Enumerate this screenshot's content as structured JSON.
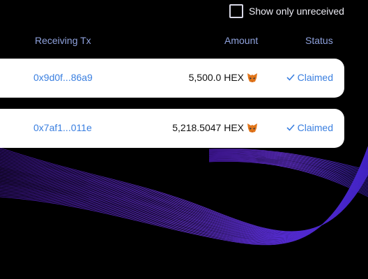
{
  "filter": {
    "label": "Show only unreceived",
    "checked": false
  },
  "columns": {
    "receiving_tx": "Receiving Tx",
    "amount": "Amount",
    "status": "Status"
  },
  "rows": [
    {
      "tx": "0x9d0f...86a9",
      "amount": "5,500.0 HEX",
      "wallet_icon": "metamask-fox-icon",
      "status_icon": "check-icon",
      "status": "Claimed"
    },
    {
      "tx": "0x7af1...011e",
      "amount": "5,218.5047 HEX",
      "wallet_icon": "metamask-fox-icon",
      "status_icon": "check-icon",
      "status": "Claimed"
    }
  ],
  "colors": {
    "background": "#000000",
    "link": "#3a7fe0",
    "header": "#8fa2dd",
    "wave": "#7a3cff"
  }
}
